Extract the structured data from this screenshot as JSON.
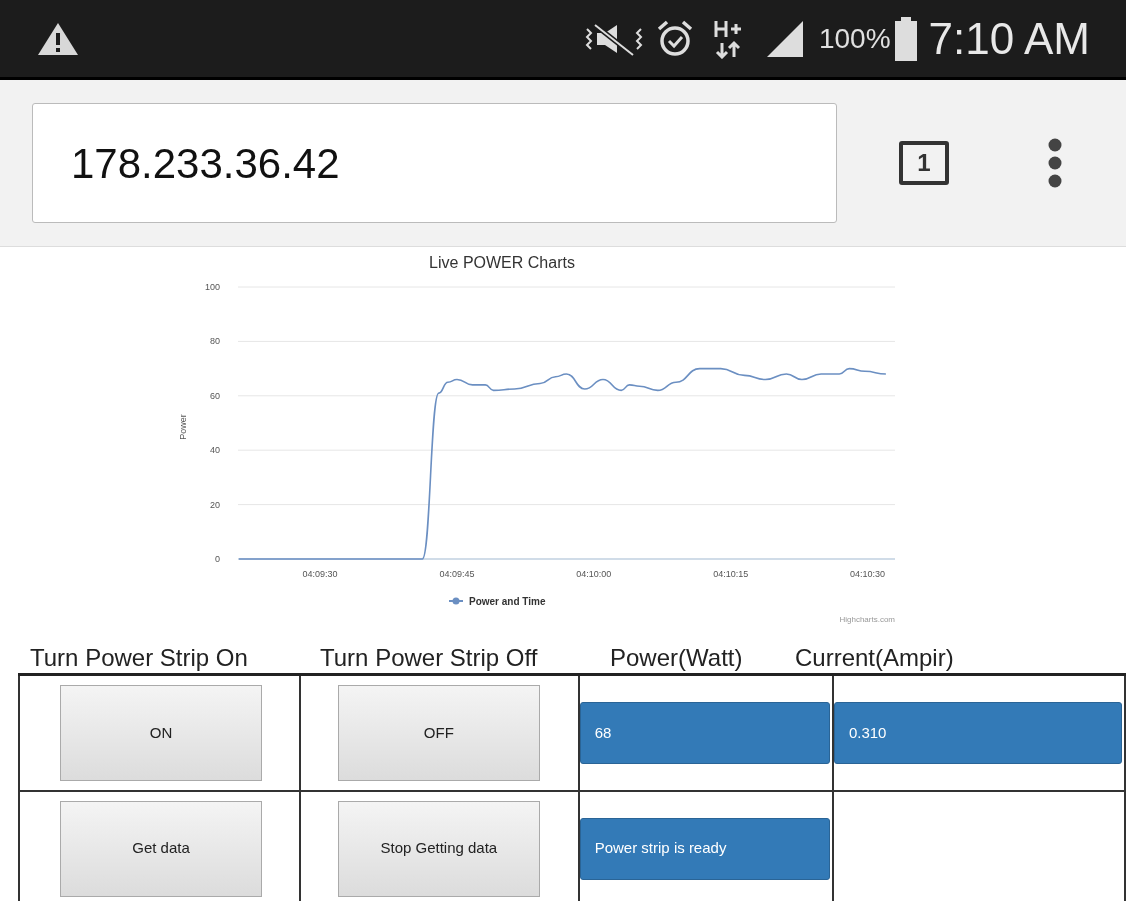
{
  "status_bar": {
    "battery": "100%",
    "time": "7:10 AM"
  },
  "browser": {
    "url": "178.233.36.42",
    "tab_count": "1"
  },
  "chart": {
    "credit": "Highcharts.com",
    "chart_data": {
      "type": "line",
      "grid": true,
      "title": "Live POWER Charts",
      "ylabel": "Power",
      "xlim": [
        14961,
        15033
      ],
      "ylim": [
        0,
        100
      ],
      "yticks": [
        0,
        20,
        40,
        60,
        80,
        100
      ],
      "xticks": [
        {
          "value": 14970,
          "label": "04:09:30"
        },
        {
          "value": 14985,
          "label": "04:09:45"
        },
        {
          "value": 15000,
          "label": "04:10:00"
        },
        {
          "value": 15015,
          "label": "04:10:15"
        },
        {
          "value": 15030,
          "label": "04:10:30"
        }
      ],
      "x": [
        14961.1,
        14981.2,
        14983,
        14984,
        14985,
        14986.7,
        14988.1,
        14989,
        14991.3,
        14994.1,
        14995.8,
        14997,
        14999,
        15001,
        15003,
        15003.9,
        15005,
        15007,
        15009,
        15011.6,
        15013.9,
        15016.5,
        15018.8,
        15021.1,
        15022.8,
        15024.9,
        15026.9,
        15028,
        15029.7,
        15032
      ],
      "series": [
        {
          "name": "Power and Time",
          "color": "#6b8fc2",
          "values": [
            0,
            0,
            61,
            65,
            66,
            64,
            64,
            62,
            62.5,
            64.5,
            67,
            68,
            62.5,
            66,
            62,
            64,
            63.5,
            62,
            65,
            70,
            70,
            67.5,
            66,
            68,
            66,
            68,
            68,
            70,
            69,
            68
          ]
        }
      ]
    }
  },
  "table": {
    "columns": [
      "Turn Power Strip On",
      "Turn Power Strip Off",
      "Power(Watt)",
      "Current(Ampir)"
    ],
    "rows": [
      {
        "cells": [
          {
            "kind": "button",
            "text": "ON"
          },
          {
            "kind": "button",
            "text": "OFF"
          },
          {
            "kind": "value",
            "text": "68"
          },
          {
            "kind": "value",
            "text": "0.310"
          }
        ]
      },
      {
        "cells": [
          {
            "kind": "button",
            "text": "Get data"
          },
          {
            "kind": "button",
            "text": "Stop Getting data"
          },
          {
            "kind": "value",
            "text": "Power strip is ready"
          }
        ]
      }
    ]
  }
}
